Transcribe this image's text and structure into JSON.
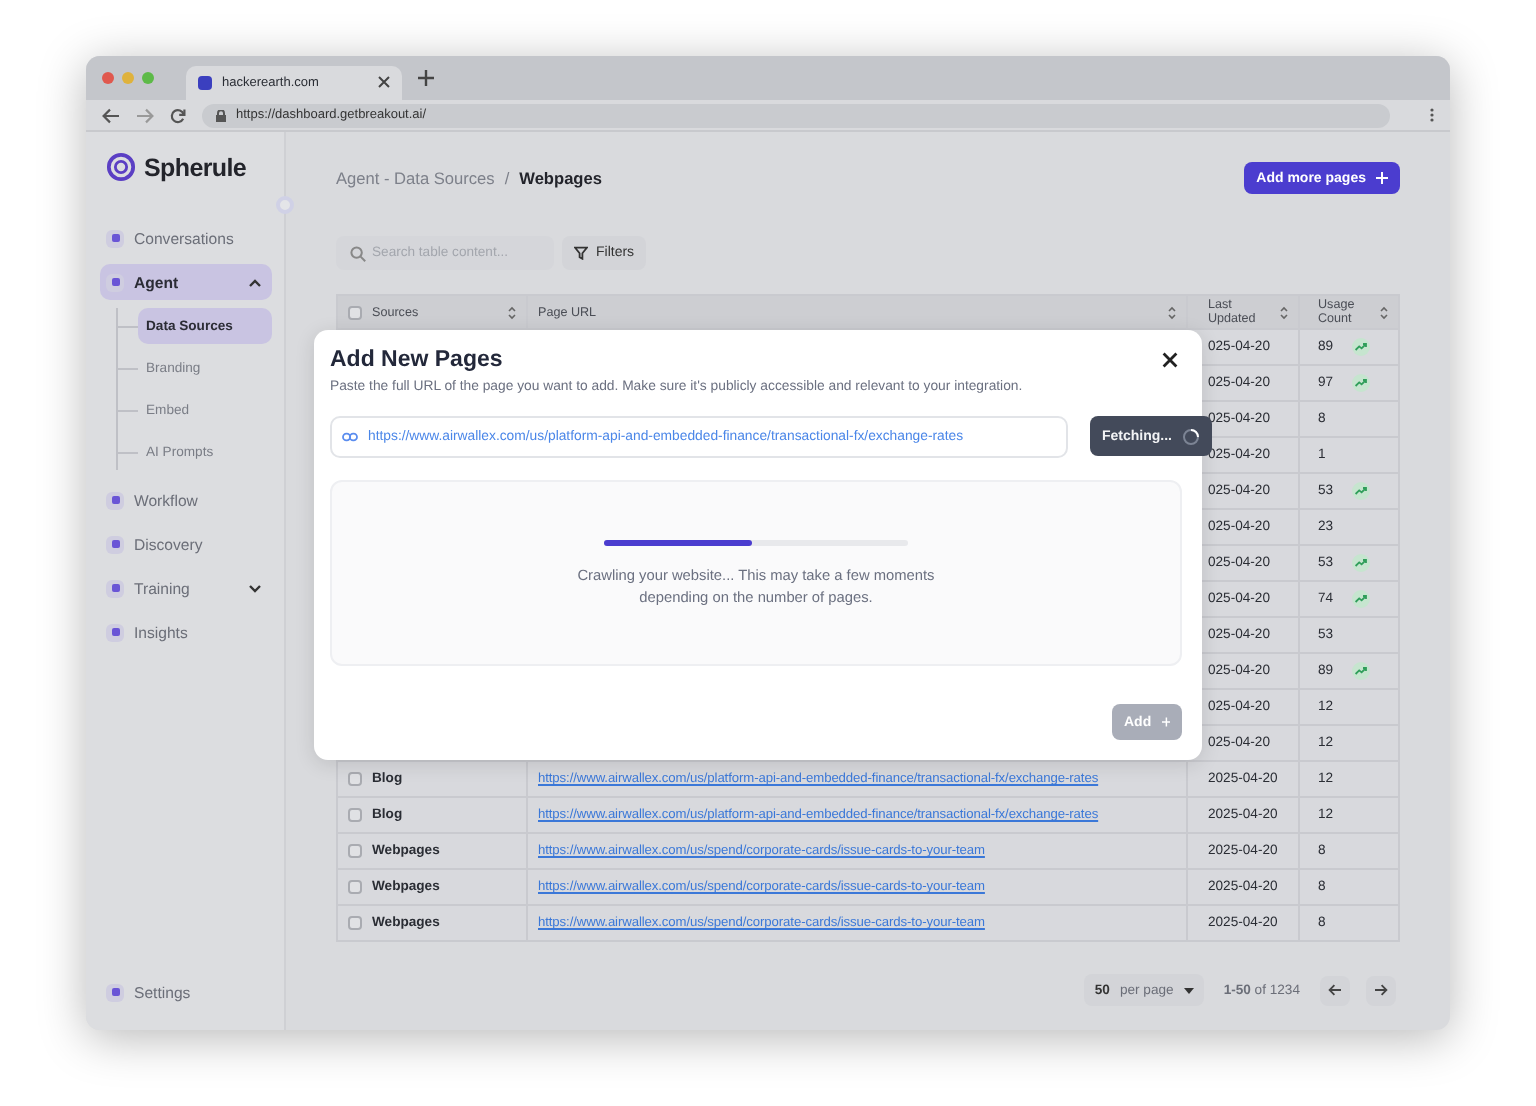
{
  "browser": {
    "tabs": [
      {
        "title": "hackerearth.com",
        "selected": true
      }
    ],
    "url": "https://dashboard.getbreakout.ai/"
  },
  "sidebar": {
    "logo": "Spherule",
    "items": [
      {
        "label": "Conversations",
        "selected": false
      },
      {
        "label": "Agent",
        "selected": true,
        "expanded": true,
        "children": [
          {
            "label": "Data Sources",
            "selected": true
          },
          {
            "label": "Branding",
            "selected": false
          },
          {
            "label": "Embed",
            "selected": false
          },
          {
            "label": "AI Prompts",
            "selected": false
          }
        ]
      },
      {
        "label": "Workflow",
        "selected": false
      },
      {
        "label": "Discovery",
        "selected": false
      },
      {
        "label": "Training",
        "selected": false,
        "expanded": false
      },
      {
        "label": "Insights",
        "selected": false
      }
    ],
    "footer_item": "Settings"
  },
  "breadcrumb": [
    "Agent - Data Sources",
    "Webpages"
  ],
  "breadcrumb_separator": "/",
  "add_more_button": "Add more pages",
  "search": {
    "placeholder": "Search table content..."
  },
  "filters_button": "Filters",
  "table": {
    "select_all_checked": false,
    "columns": [
      "Sources",
      "Page URL",
      "Last Updated",
      "Usage Count"
    ],
    "rows": [
      {
        "last_updated": "025-04-20",
        "usage_count": "89",
        "trending": true
      },
      {
        "last_updated": "025-04-20",
        "usage_count": "97",
        "trending": true
      },
      {
        "last_updated": "025-04-20",
        "usage_count": "8",
        "trending": false
      },
      {
        "last_updated": "025-04-20",
        "usage_count": "1",
        "trending": false
      },
      {
        "last_updated": "025-04-20",
        "usage_count": "53",
        "trending": true
      },
      {
        "last_updated": "025-04-20",
        "usage_count": "23",
        "trending": false
      },
      {
        "last_updated": "025-04-20",
        "usage_count": "53",
        "trending": true
      },
      {
        "last_updated": "025-04-20",
        "usage_count": "74",
        "trending": true
      },
      {
        "last_updated": "025-04-20",
        "usage_count": "53",
        "trending": false
      },
      {
        "last_updated": "025-04-20",
        "usage_count": "89",
        "trending": true
      },
      {
        "last_updated": "025-04-20",
        "usage_count": "12",
        "trending": false
      },
      {
        "last_updated": "025-04-20",
        "usage_count": "12",
        "trending": false
      },
      {
        "checked": false,
        "source": "Blog",
        "url": "https://www.airwallex.com/us/platform-api-and-embedded-finance/transactional-fx/exchange-rates",
        "last_updated": "2025-04-20",
        "usage_count": "12",
        "trending": false
      },
      {
        "checked": false,
        "source": "Blog",
        "url": "https://www.airwallex.com/us/platform-api-and-embedded-finance/transactional-fx/exchange-rates",
        "last_updated": "2025-04-20",
        "usage_count": "12",
        "trending": false
      },
      {
        "checked": false,
        "source": "Webpages",
        "url": "https://www.airwallex.com/us/spend/corporate-cards/issue-cards-to-your-team",
        "last_updated": "2025-04-20",
        "usage_count": "8",
        "trending": false
      },
      {
        "checked": false,
        "source": "Webpages",
        "url": "https://www.airwallex.com/us/spend/corporate-cards/issue-cards-to-your-team",
        "last_updated": "2025-04-20",
        "usage_count": "8",
        "trending": false
      },
      {
        "checked": false,
        "source": "Webpages",
        "url": "https://www.airwallex.com/us/spend/corporate-cards/issue-cards-to-your-team",
        "last_updated": "2025-04-20",
        "usage_count": "8",
        "trending": false
      }
    ]
  },
  "pagination": {
    "per_page": "50",
    "per_page_label": "per page",
    "range": "**1-50** of 1234"
  },
  "modal": {
    "title": "Add New Pages",
    "description": "Paste the full URL of the page you want to add. Make sure it's publicly accessible and relevant to your integration.",
    "url_value": "https://www.airwallex.com/us/platform-api-and-embedded-finance/transactional-fx/exchange-rates",
    "fetch_button": "Fetching...",
    "progress": {
      "level": 0.49
    },
    "message": "Crawling your website... This may take a few moments depending on the number of pages.",
    "add_button": {
      "label": "Add",
      "disabled": true
    }
  }
}
